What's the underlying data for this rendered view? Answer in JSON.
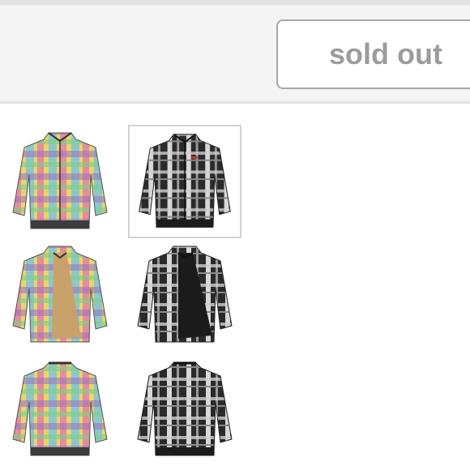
{
  "header": {
    "status_button_label": "sold out"
  },
  "colors": {
    "topbar_bg": "#f4f4f4",
    "button_border": "#a8a8a8",
    "button_text": "#9c9c9c",
    "selected_border": "#d2d2d2"
  },
  "thumbnails": [
    {
      "name": "multicolor-plaid-jacket-front",
      "colorway": "multicolor",
      "view": "front"
    },
    {
      "name": "black-plaid-jacket-front",
      "colorway": "black",
      "view": "front",
      "selected": true
    },
    {
      "name": "multicolor-plaid-jacket-open",
      "colorway": "multicolor",
      "view": "open"
    },
    {
      "name": "black-plaid-jacket-open",
      "colorway": "black",
      "view": "open"
    },
    {
      "name": "multicolor-plaid-jacket-back",
      "colorway": "multicolor",
      "view": "back"
    },
    {
      "name": "black-plaid-jacket-back",
      "colorway": "black",
      "view": "back"
    }
  ]
}
